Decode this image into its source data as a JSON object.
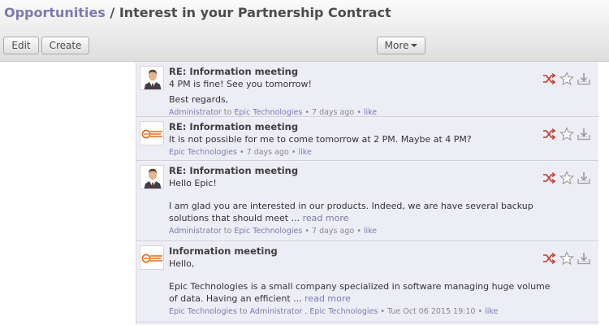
{
  "breadcrumb": {
    "parent": "Opportunities",
    "separator": "/",
    "current": "Interest in your Partnership Contract"
  },
  "toolbar": {
    "edit_label": "Edit",
    "create_label": "Create",
    "more_label": "More"
  },
  "colors": {
    "link": "#7c7bad",
    "message_bg": "#ededf6",
    "unread_icon": "#c0392b"
  },
  "messages": [
    {
      "avatar": "man-portrait-icon",
      "title": "RE: Information meeting",
      "lines": [
        "4 PM is fine! See you tomorrow!",
        "Best regards,"
      ],
      "author": "Administrator",
      "to_word": "to",
      "recipients": [
        "Epic Technologies"
      ],
      "time": "7 days ago",
      "like": "like"
    },
    {
      "avatar": "epic-logo-icon",
      "title": "RE: Information meeting",
      "lines": [
        "It is not possible for me to come tomorrow at 2 PM. Maybe at 4 PM?"
      ],
      "author": "Epic Technologies",
      "time": "7 days ago",
      "like": "like"
    },
    {
      "avatar": "man-portrait-icon",
      "title": "RE: Information meeting",
      "lines": [
        "Hello Epic!",
        "I am glad you are interested in our products. Indeed, we are have several backup",
        "solutions that should meet ..."
      ],
      "read_more": "read more",
      "author": "Administrator",
      "to_word": "to",
      "recipients": [
        "Epic Technologies"
      ],
      "time": "7 days ago",
      "like": "like"
    },
    {
      "avatar": "epic-logo-icon",
      "title": "Information meeting",
      "lines": [
        "Hello,",
        "Epic Technologies is a small company specialized in software managing huge volume",
        "of data. Having an efficient ..."
      ],
      "read_more": "read more",
      "author": "Epic Technologies",
      "to_word": "to",
      "recipients": [
        "Administrator",
        "Epic Technologies"
      ],
      "recipient_sep": ",",
      "time": "Tue Oct 06 2015 19:10",
      "like": "like"
    }
  ],
  "meta_dot": "•",
  "action_icons": [
    "mark-unread-icon",
    "star-icon",
    "archive-icon"
  ]
}
